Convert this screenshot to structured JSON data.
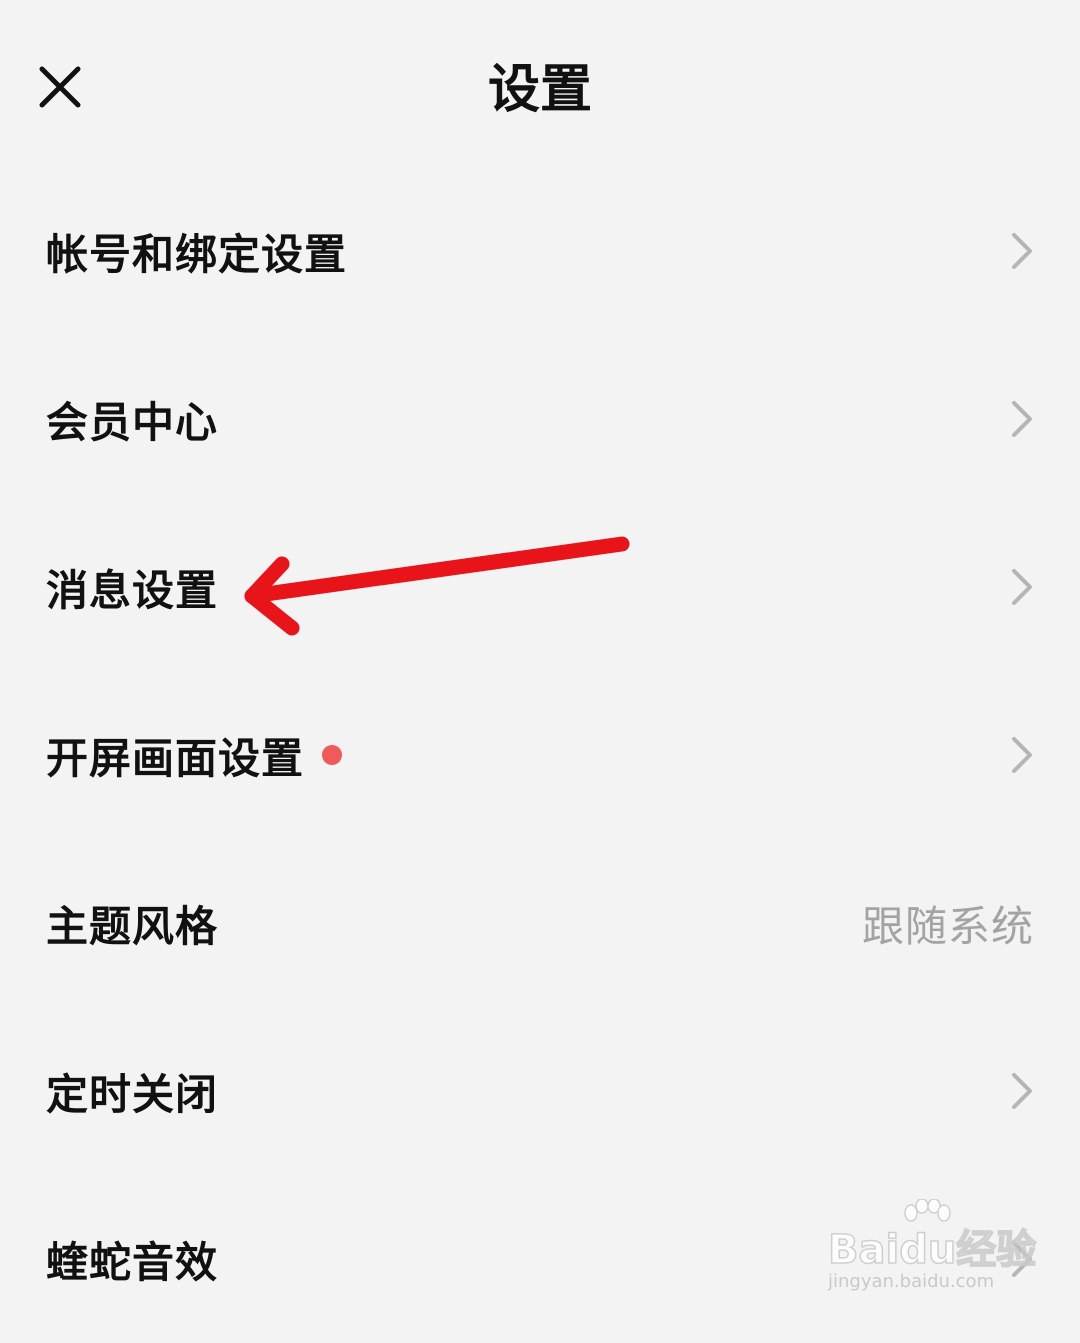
{
  "header": {
    "title": "设置",
    "close_icon": "close-icon"
  },
  "settings": [
    {
      "label": "帐号和绑定设置",
      "has_chevron": true
    },
    {
      "label": "会员中心",
      "has_chevron": true
    },
    {
      "label": "消息设置",
      "has_chevron": true
    },
    {
      "label": "开屏画面设置",
      "has_chevron": true,
      "badge_color": "#f05a5a"
    },
    {
      "label": "主题风格",
      "value": "跟随系统"
    },
    {
      "label": "定时关闭",
      "has_chevron": true
    },
    {
      "label": "蝰蛇音效",
      "has_chevron": true
    }
  ],
  "annotation": {
    "arrow_color": "#e8141a",
    "points_to": "消息设置"
  },
  "watermark": {
    "logo": "Baidu经验",
    "url": "jingyan.baidu.com"
  },
  "colors": {
    "background": "#f3f3f3",
    "text": "#111111",
    "secondary_text": "#a3a3a3",
    "chevron": "#b5b5b5"
  }
}
